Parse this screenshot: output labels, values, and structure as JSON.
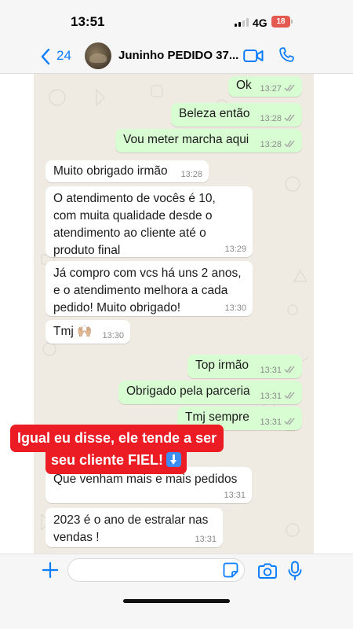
{
  "status_bar": {
    "time": "13:51",
    "network": "4G",
    "battery": "18"
  },
  "header": {
    "back_count": "24",
    "contact_name": "Juninho PEDIDO 37..."
  },
  "messages": [
    {
      "dir": "out",
      "text": "Ok",
      "time": "13:27",
      "read": true
    },
    {
      "dir": "out",
      "text": "Beleza então",
      "time": "13:28",
      "read": true
    },
    {
      "dir": "out",
      "text": "Vou meter marcha aqui",
      "time": "13:28",
      "read": true
    },
    {
      "dir": "in",
      "text": "Muito obrigado irmão",
      "time": "13:28"
    },
    {
      "dir": "in",
      "text": "O atendimento de vocês é 10, com muita qualidade desde o atendimento ao cliente até o produto final",
      "time": "13:29"
    },
    {
      "dir": "in",
      "text": "Já compro com vcs há uns 2 anos, e o atendimento melhora a cada pedido! Muito obrigado!",
      "time": "13:30"
    },
    {
      "dir": "in",
      "text": "Tmj 🙌🏼",
      "time": "13:30"
    },
    {
      "dir": "out",
      "text": "Top irmão",
      "time": "13:31",
      "read": true
    },
    {
      "dir": "out",
      "text": "Obrigado pela parceria",
      "time": "13:31",
      "read": true
    },
    {
      "dir": "out",
      "text": "Tmj sempre",
      "time": "13:31",
      "read": true
    },
    {
      "dir": "in",
      "text": "Que venham mais e mais pedidos",
      "time": "13:31"
    },
    {
      "dir": "in",
      "text": "2023 é o ano de estralar nas vendas !",
      "time": "13:31"
    }
  ],
  "overlay": {
    "line1": "Igual eu disse, ele tende a ser",
    "line2": "seu cliente FIEL!",
    "emoji": "⬇️"
  },
  "colors": {
    "accent": "#0a7cff",
    "outgoing": "#d9fdd3",
    "incoming": "#ffffff",
    "overlay": "#ec1c24",
    "read_ticks": "#53bdeb"
  }
}
